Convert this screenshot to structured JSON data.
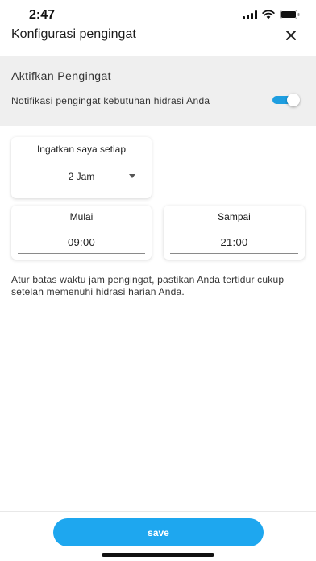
{
  "status_bar": {
    "time": "2:47",
    "icons": [
      "signal-icon",
      "wifi-icon",
      "battery-icon"
    ]
  },
  "header": {
    "title": "Konfigurasi pengingat",
    "close_icon": "close-icon"
  },
  "reminder": {
    "title": "Aktifkan Pengingat",
    "description": "Notifikasi pengingat kebutuhan hidrasi Anda",
    "enabled": true
  },
  "interval": {
    "label": "Ingatkan saya setiap",
    "selected": "2 Jam"
  },
  "schedule": {
    "start_label": "Mulai",
    "start_value": "09:00",
    "end_label": "Sampai",
    "end_value": "21:00"
  },
  "info_text": "Atur batas waktu jam pengingat, pastikan Anda tertidur cukup setelah memenuhi hidrasi harian Anda.",
  "footer": {
    "save_label": "save"
  },
  "colors": {
    "accent": "#1ea7ef",
    "toggle_track": "#1e9ee0",
    "band_background": "#efefef"
  }
}
